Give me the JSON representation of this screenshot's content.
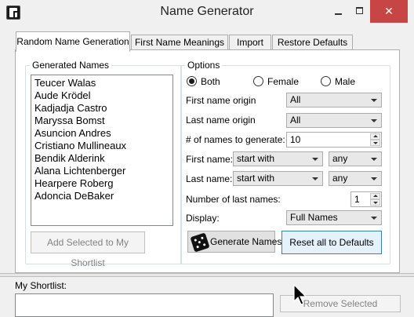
{
  "window": {
    "title": "Name Generator",
    "controls": {
      "minimize": "—",
      "maximize": "☐",
      "close": "✕"
    }
  },
  "tabs": [
    {
      "label": "Random Name Generation",
      "active": true
    },
    {
      "label": "First Name Meanings",
      "active": false
    },
    {
      "label": "Import",
      "active": false
    },
    {
      "label": "Restore Defaults",
      "active": false
    }
  ],
  "generated": {
    "label": "Generated Names",
    "names": [
      "Teucer Walas",
      "Aude Krödel",
      "Kadjadja Castro",
      "Maryssa Bomst",
      "Asuncion Andres",
      "Cristiano Mullineaux",
      "Bendik Alderink",
      "Alana Lichtenberger",
      "Hearpere Roberg",
      "Adoncia DeBaker"
    ],
    "add_button": "Add Selected to My Shortlist"
  },
  "options": {
    "label": "Options",
    "gender": {
      "both": "Both",
      "female": "Female",
      "male": "Male",
      "selected": "Both"
    },
    "first_origin": {
      "label": "First name origin",
      "value": "All"
    },
    "last_origin": {
      "label": "Last name origin",
      "value": "All"
    },
    "count": {
      "label": "# of names to generate:",
      "value": "10"
    },
    "first_name": {
      "label": "First name:",
      "mode": "start with",
      "value": "any"
    },
    "last_name": {
      "label": "Last name:",
      "mode": "start with",
      "value": "any"
    },
    "num_last": {
      "label": "Number of last names:",
      "value": "1"
    },
    "display": {
      "label": "Display:",
      "value": "Full Names"
    },
    "generate_button": "Generate Names",
    "reset_button": "Reset all to Defaults"
  },
  "shortlist": {
    "label": "My Shortlist:",
    "remove_button": "Remove Selected"
  },
  "icons": {
    "app": "app-logo-icon",
    "dice": "dice-icon",
    "cursor": "mouse-pointer-icon"
  },
  "colors": {
    "close_button": "#c74545",
    "focus_border": "#3c7fb1"
  }
}
